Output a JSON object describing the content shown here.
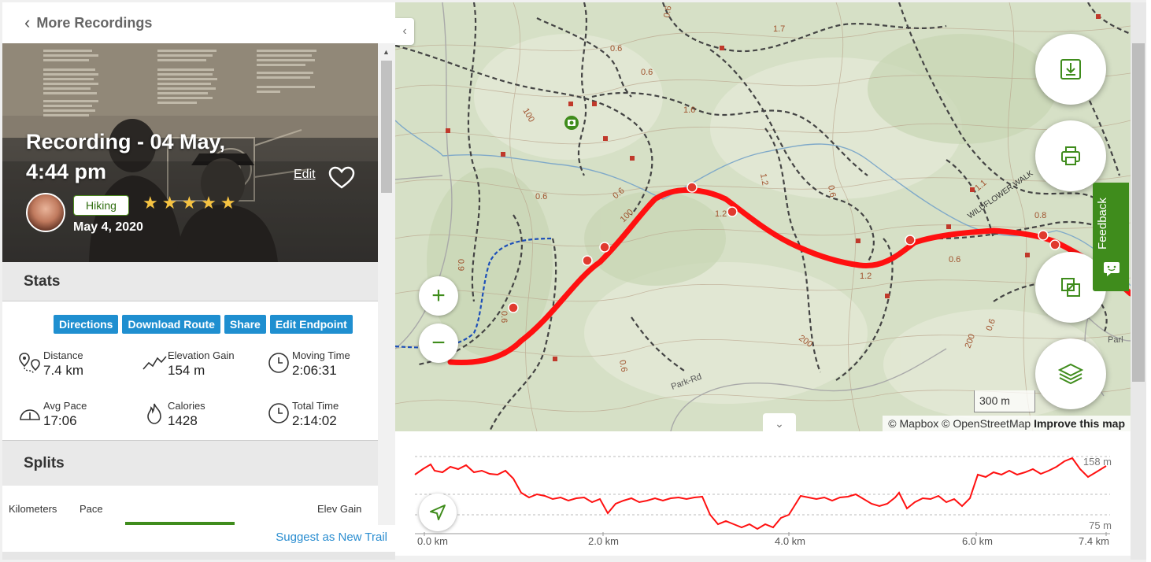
{
  "nav": {
    "back_label": "More Recordings"
  },
  "hero": {
    "title": "Recording - 04 May, 4:44 pm",
    "edit_label": "Edit",
    "activity": "Hiking",
    "rating": 5,
    "stars": "★★★★★",
    "date": "May 4, 2020"
  },
  "stats": {
    "heading": "Stats",
    "actions": [
      "Directions",
      "Download Route",
      "Share",
      "Edit Endpoint"
    ],
    "items": [
      {
        "label": "Distance",
        "value": "7.4 km",
        "icon": "distance-icon"
      },
      {
        "label": "Elevation Gain",
        "value": "154 m",
        "icon": "elevation-icon"
      },
      {
        "label": "Moving Time",
        "value": "2:06:31",
        "icon": "clock-icon"
      },
      {
        "label": "Avg Pace",
        "value": "17:06",
        "icon": "pace-gauge-icon"
      },
      {
        "label": "Calories",
        "value": "1428",
        "icon": "flame-icon"
      },
      {
        "label": "Total Time",
        "value": "2:14:02",
        "icon": "clock-icon"
      }
    ]
  },
  "splits": {
    "heading": "Splits",
    "columns": [
      "Kilometers",
      "Pace",
      "Elev Gain"
    ]
  },
  "suggest_label": "Suggest as New Trail",
  "map": {
    "labels": [
      "0.6",
      "1.7",
      "0.6",
      "0.6",
      "100",
      "1.6",
      "1.2",
      "1.2",
      "0.6",
      "0.6",
      "0.6",
      "100",
      "1.1",
      "0.8",
      "WILDFLOWER WALK",
      "0.6",
      "0.9",
      "0.6",
      "1.2",
      "200",
      "200",
      "0.6",
      "Park-Rd",
      "0.6",
      "Parl"
    ],
    "scale": "300 m",
    "attribution": "© Mapbox © OpenStreetMap",
    "improve": "Improve this map",
    "feedback": "Feedback",
    "route_color": "#ff0000",
    "accent": "#3f8c1c"
  },
  "elevation": {
    "max_label": "158 m",
    "min_label": "75 m",
    "x_ticks": [
      "0.0 km",
      "2.0 km",
      "4.0 km",
      "6.0 km",
      "7.4 km"
    ]
  }
}
